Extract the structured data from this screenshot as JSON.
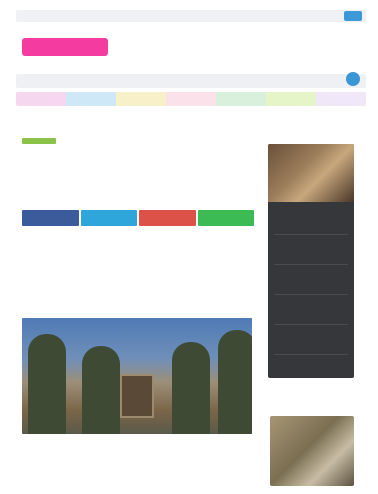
{
  "header": {
    "logo_text": "",
    "top_button": ""
  },
  "strip_colors": [
    "#f6d7f0",
    "#cfe8f7",
    "#f8f0c8",
    "#fbe2ea",
    "#d9f1dc",
    "#e6f5c8",
    "#f0e7f8"
  ],
  "article": {
    "breadcrumb": "",
    "headline": "",
    "tag_color": "#8bc34a",
    "share_buttons": [
      {
        "label": "",
        "color": "#3b5b9a"
      },
      {
        "label": "",
        "color": "#2ea6dc"
      },
      {
        "label": "",
        "color": "#dc5148"
      },
      {
        "label": "",
        "color": "#3cba54"
      }
    ],
    "meta": "",
    "intro": "",
    "body": ""
  },
  "sidebar": {
    "title": "",
    "items": [
      "",
      "",
      "",
      "",
      "",
      "",
      ""
    ],
    "title2": ""
  },
  "colors": {
    "accent_blue": "#3d98d8",
    "logo_pink": "#f43ca0",
    "sidebar_bg": "#35373b"
  }
}
